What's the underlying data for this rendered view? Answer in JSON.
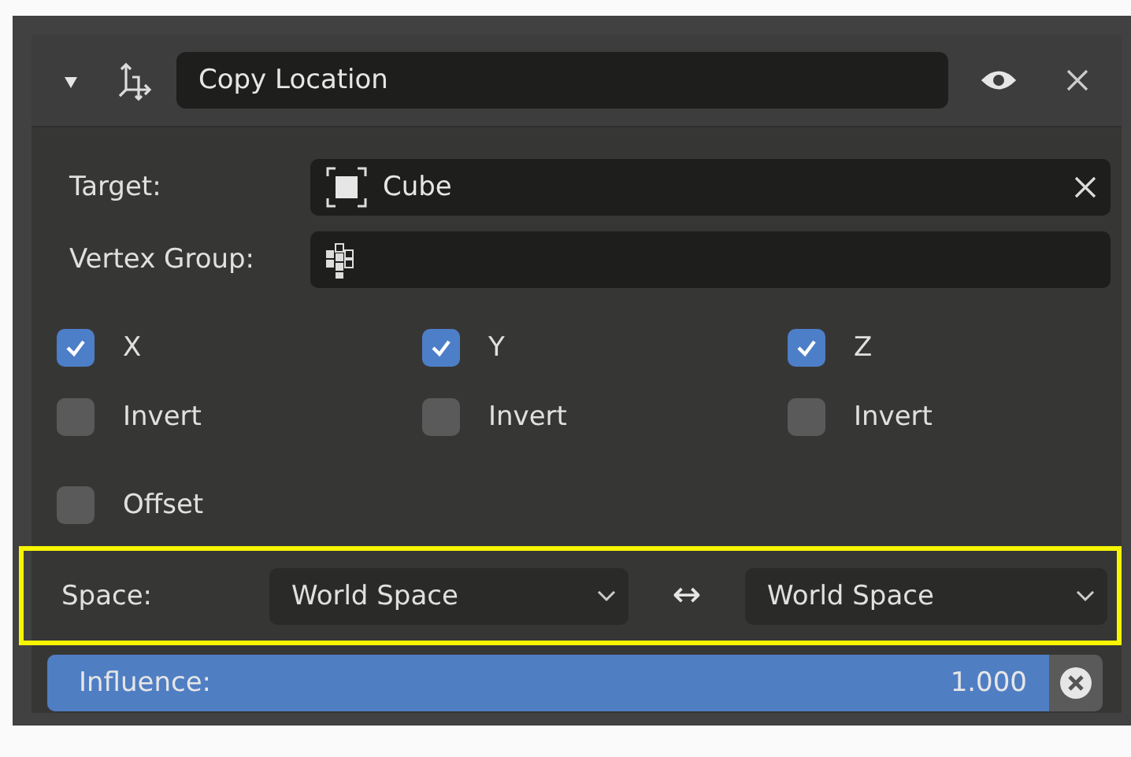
{
  "header": {
    "expanded": true,
    "name": "Copy Location",
    "visible": true
  },
  "target": {
    "label": "Target:",
    "value": "Cube"
  },
  "vertex_group": {
    "label": "Vertex Group:"
  },
  "axes": [
    {
      "label": "X",
      "checked": true
    },
    {
      "label": "Y",
      "checked": true
    },
    {
      "label": "Z",
      "checked": true
    }
  ],
  "inverts": [
    {
      "label": "Invert",
      "checked": false
    },
    {
      "label": "Invert",
      "checked": false
    },
    {
      "label": "Invert",
      "checked": false
    }
  ],
  "offset": {
    "label": "Offset",
    "checked": false
  },
  "space": {
    "label": "Space:",
    "owner": "World Space",
    "arrow": "↔",
    "target": "World Space",
    "highlighted": true
  },
  "influence": {
    "label": "Influence:",
    "reading": "1.000",
    "level": 1
  }
}
